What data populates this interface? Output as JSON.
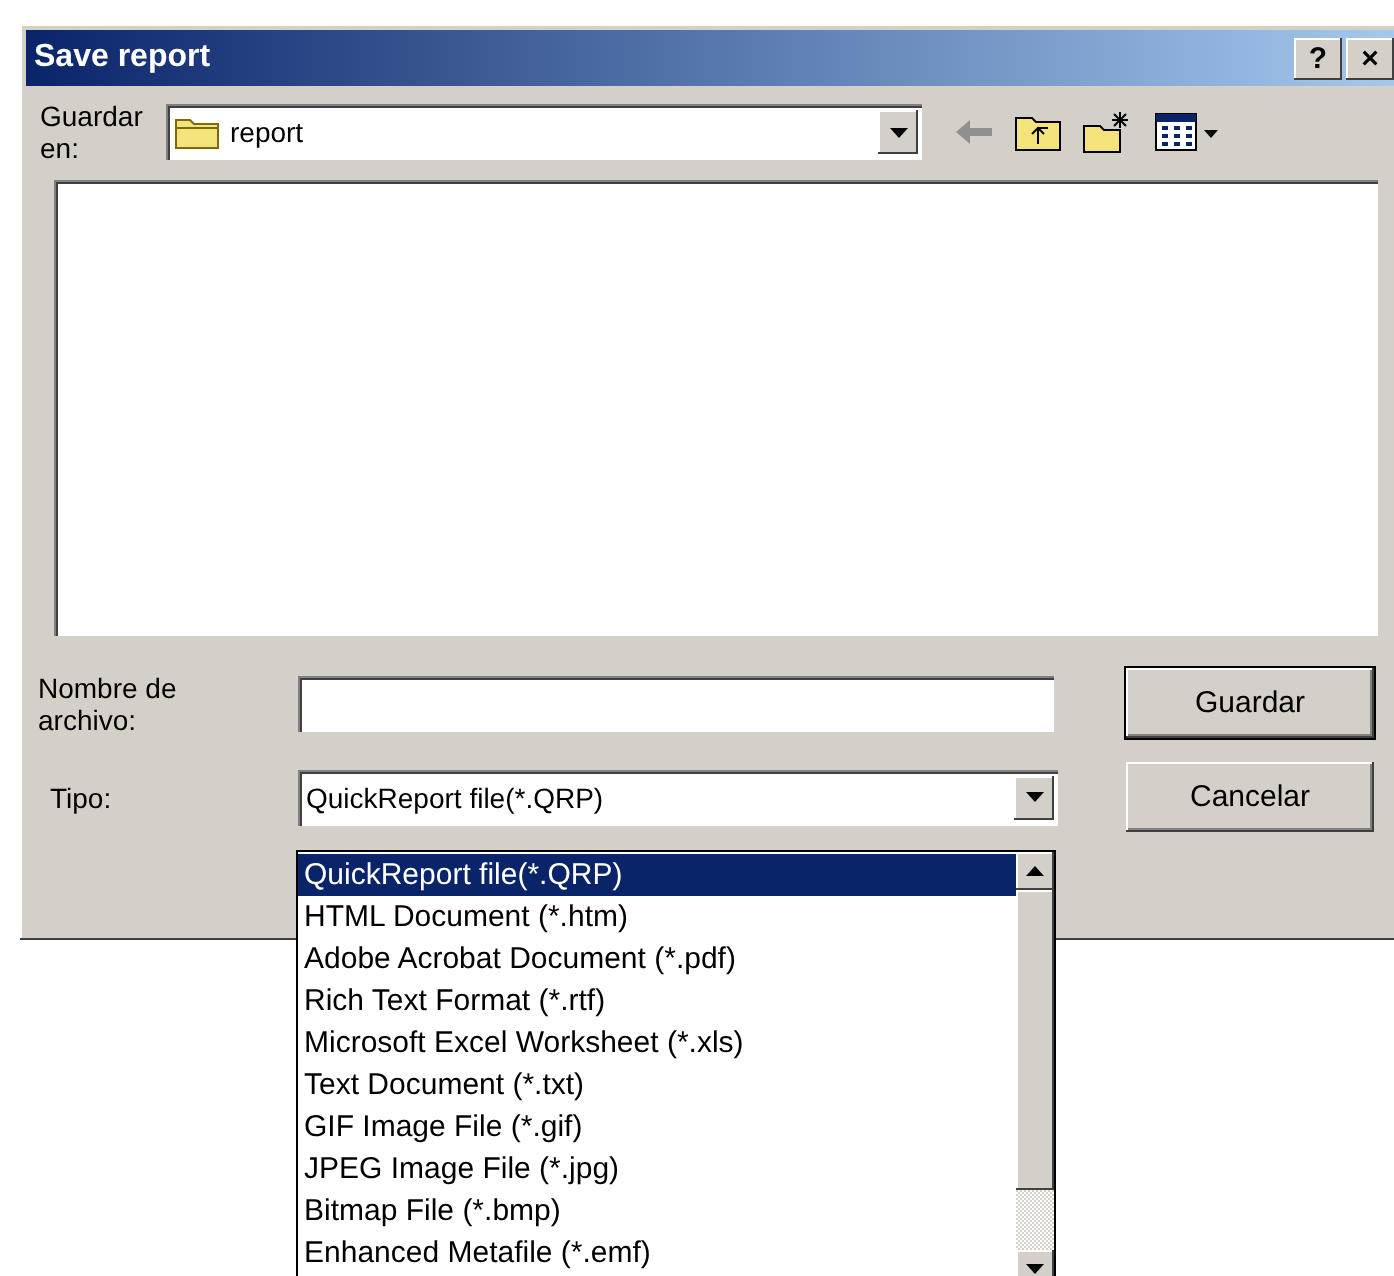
{
  "window": {
    "title": "Save report"
  },
  "title_buttons": [
    "?",
    "×"
  ],
  "save_in": {
    "label": "Guardar en:",
    "value": "report"
  },
  "file_name": {
    "label": "Nombre de archivo:"
  },
  "file_type": {
    "label": "Tipo:",
    "value": "QuickReport file(*.QRP)",
    "expanded": true
  },
  "buttons": [
    "Guardar",
    "Cancelar"
  ],
  "file_type_options": [
    {
      "label": "QuickReport file(*.QRP)",
      "selected": true
    },
    {
      "label": "HTML Document (*.htm)",
      "selected": false
    },
    {
      "label": "Adobe Acrobat Document (*.pdf)",
      "selected": false
    },
    {
      "label": "Rich Text Format (*.rtf)",
      "selected": false
    },
    {
      "label": "Microsoft Excel Worksheet (*.xls)",
      "selected": false
    },
    {
      "label": "Text Document (*.txt)",
      "selected": false
    },
    {
      "label": "GIF Image File (*.gif)",
      "selected": false
    },
    {
      "label": "JPEG Image File (*.jpg)",
      "selected": false
    },
    {
      "label": "Bitmap File (*.bmp)",
      "selected": false
    },
    {
      "label": "Enhanced Metafile (*.emf)",
      "selected": false
    }
  ]
}
